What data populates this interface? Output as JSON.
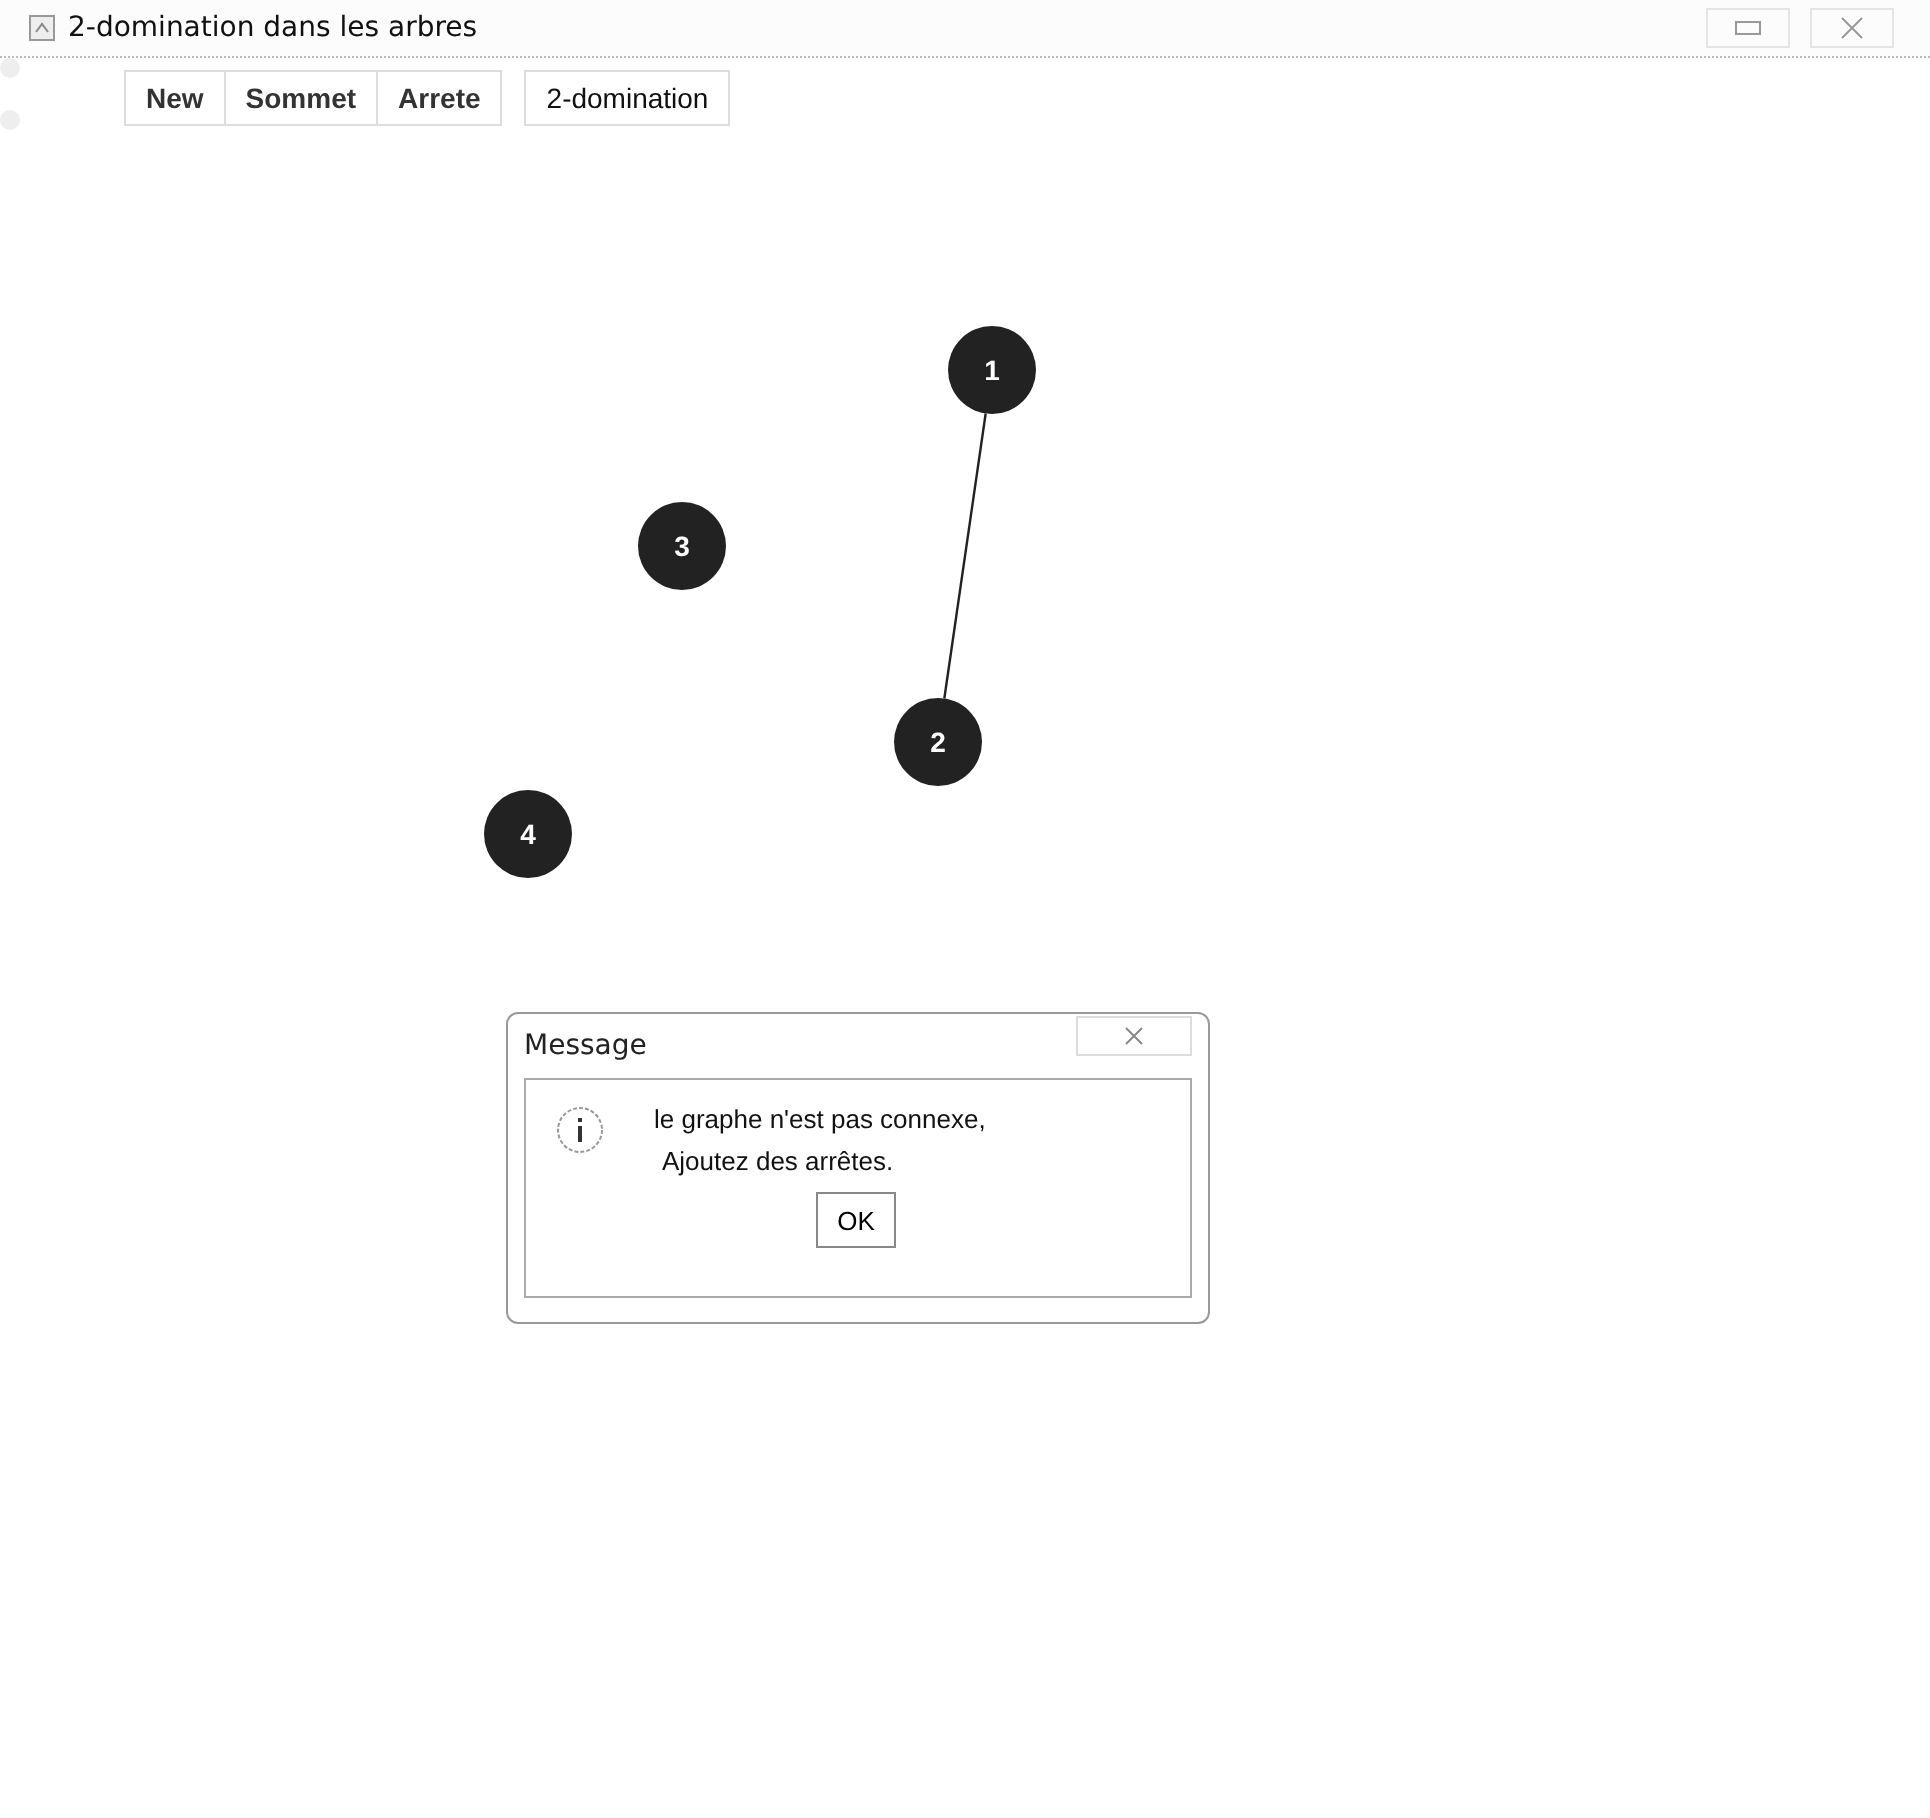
{
  "window": {
    "title": "2-domination dans les arbres"
  },
  "toolbar": [
    {
      "label": "New"
    },
    {
      "label": "Sommet"
    },
    {
      "label": "Arrete"
    },
    {
      "label": "2-domination"
    }
  ],
  "graph": {
    "nodes": [
      {
        "label": "1"
      },
      {
        "label": "3"
      },
      {
        "label": "2"
      },
      {
        "label": "4"
      }
    ],
    "edges": [
      {
        "kind": "line"
      }
    ]
  },
  "dialog": {
    "title": "Message",
    "lines": [
      "le graphe n'est pas connexe,",
      "Ajoutez des arrêtes."
    ],
    "button": "OK"
  }
}
